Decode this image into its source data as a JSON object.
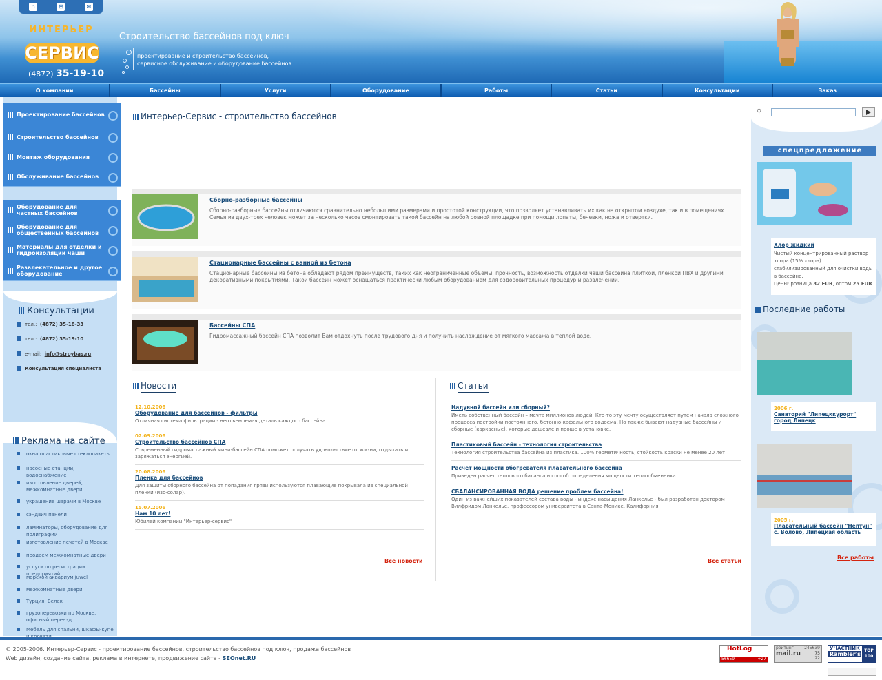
{
  "header": {
    "slogan": "Строительство бассейнов под ключ",
    "sub1": "проектирование и строительство бассейнов,",
    "sub2": "сервисное обслуживание и оборудование бассейнов",
    "logo_top": "ИНТЕРЬЕР",
    "logo_main": "СЕРВИС",
    "logo_phone_code": "(4872)",
    "logo_phone": "35-19-10"
  },
  "nav": [
    "О компании",
    "Бассейны",
    "Услуги",
    "Оборудование",
    "Работы",
    "Статьи",
    "Консультации",
    "Заказ"
  ],
  "menu1": [
    "Проектирование бассейнов",
    "Строительство бассейнов",
    "Монтаж оборудования",
    "Обслуживание бассейнов"
  ],
  "menu2": [
    "Оборудование для частных бассейнов",
    "Оборудование для общественных бассейнов",
    "Материалы для отделки и гидроизоляции чаши",
    "Развлекательное и другое оборудование"
  ],
  "consult": {
    "title": "Консультации",
    "tel_label": "тел.:",
    "tel1": "(4872) 35-18-33",
    "tel2": "(4872) 35-19-10",
    "email_label": "e-mail:",
    "email": "info@stroybas.ru",
    "specialist": "Консультация специалиста"
  },
  "ads": {
    "title": "Реклама на сайте",
    "items": [
      "окна пластиковые стеклопакеты",
      "насосные станции, водоснабжение",
      "изготовление дверей, межкомнатные двери",
      "украшение шарами в Москве",
      "сэндвич панели",
      "ламинаторы, оборудование для полиграфии",
      "изготовление печатей в Москве",
      "продаем межкомнатные двери",
      "услуги по регистрации предприятий",
      "морской аквариум juwel",
      "межкомнатные двери",
      "Турция, Белек",
      "грузоперевозки по Москве, офисный переезд",
      "Мебель для спальни, шкафы-купе и кровати"
    ]
  },
  "main": {
    "title": "Интерьер-Сервис - строительство бассейнов",
    "products": [
      {
        "title": "Сборно-разборные бассейны",
        "text": "Сборно-разборные бассейны отличаются сравнительно небольшими размерами и простотой конструкции, что позволяет устанавливать их как на открытом воздухе, так и в помещениях. Семья из двух-трех человек может за несколько часов смонтировать такой бассейн на любой ровной площадке при помощи лопаты, бечевки, ножа и отвертки."
      },
      {
        "title": "Стационарные бассейны с ванной из бетона",
        "text": "Стационарные бассейны из бетона обладают рядом преимуществ, таких как неограниченные объемы, прочность, возможность отделки чаши бассейна плиткой, пленкой ПВХ и другими декоративными покрытиями. Такой бассейн может оснащаться практически любым оборудованием для оздоровительных процедур и развлечений."
      },
      {
        "title": "Бассейны СПА",
        "text": "Гидромассажный бассейн СПА позволит Вам отдохнуть после трудового дня и получить наслаждение от мягкого массажа в теплой воде."
      }
    ],
    "news_title": "Новости",
    "news": [
      {
        "date": "12.10.2006",
        "title": "Оборудование для бассейнов - фильтры",
        "text": "Отличная система фильтрации - неотъемлемая деталь каждого бассейна."
      },
      {
        "date": "02.09.2006",
        "title": "Строительство бассейнов СПА",
        "text": "Современный гидромассажный мини-бассейн СПА поможет получать удовольствие от жизни, отдыхать и заряжаться энергией."
      },
      {
        "date": "20.08.2006",
        "title": "Пленка для бассейнов",
        "text": "Для защиты сборного бассейна от попадания грязи используются плавающие покрывала из специальной пленки (изо-солар)."
      },
      {
        "date": "15.07.2006",
        "title": "Нам 10 лет!",
        "text": "Юбилей компании \"Интерьер-сервис\""
      }
    ],
    "all_news": "Все новости",
    "articles_title": "Статьи",
    "articles": [
      {
        "title": "Надувной бассейн или сборный?",
        "text": "Иметь собственный бассейн – мечта миллионов людей. Кто-то эту мечту осуществляет путем начала сложного процесса постройки постоянного, бетонно-кафельного водоема. Но также бывают надувные бассейны и сборные (каркасные), которые дешевле и проще в установке."
      },
      {
        "title": "Пластиковый бассейн - технология строительства",
        "text": "Технология строительства бассейна из пластика. 100% герметичность, стойкость краски не менее 20 лет!"
      },
      {
        "title": "Расчет мощности обогревателя плавательного бассейна",
        "text": "Приведен расчет теплового баланса и способ определения мощности теплообменника"
      },
      {
        "title": "СБАЛАНСИРОВАННАЯ ВОДА решение проблем бассейна!",
        "text": "Один из важнейших показателей состава воды - индекс насыщения Ланкелье - был разработан доктором Вилфридом Ланкелье, профессором университета в Санта-Монике, Калифорния."
      }
    ],
    "all_articles": "Все статьи"
  },
  "right": {
    "special_title": "спецпредложение",
    "special_item": "Хлор жидкий",
    "special_text": "Чистый концентрированный раствор хлора (15% хлора) стабилизированный для очистки воды в бассейне.",
    "price_label": "Цены: розница",
    "price_retail": "32 EUR",
    "price_opt_label": "оптом",
    "price_opt": "25 EUR",
    "works_title": "Последние работы",
    "works": [
      {
        "year": "2006 г.",
        "title": "Санаторий \"Липецккурорт\" город Липецк"
      },
      {
        "year": "2005 г.",
        "title": "Плавательный бассейн \"Нептун\" с. Волово, Липецкая область"
      }
    ],
    "all_works": "Все работы"
  },
  "footer": {
    "line1": "© 2005-2006. Интерьер-Сервис - проектирование бассейнов, строительство бассейнов под ключ, продажа бассейнов",
    "line2a": "Web дизайн, создание сайта, реклама в интернете, продвижение сайта -",
    "line2b": "SEOnet.RU"
  },
  "counters": {
    "hotlog": "HotLog",
    "hotlog_n1": "56659",
    "hotlog_n2": "+27",
    "mail_label": "рейтинг",
    "mail_n1": "245639",
    "mail_n2": "75",
    "mail_n3": "22",
    "mail_logo": "mail.ru",
    "rambler1": "УЧАСТНИК",
    "rambler2": "Rambler's",
    "rambler3": "TOP 100"
  }
}
